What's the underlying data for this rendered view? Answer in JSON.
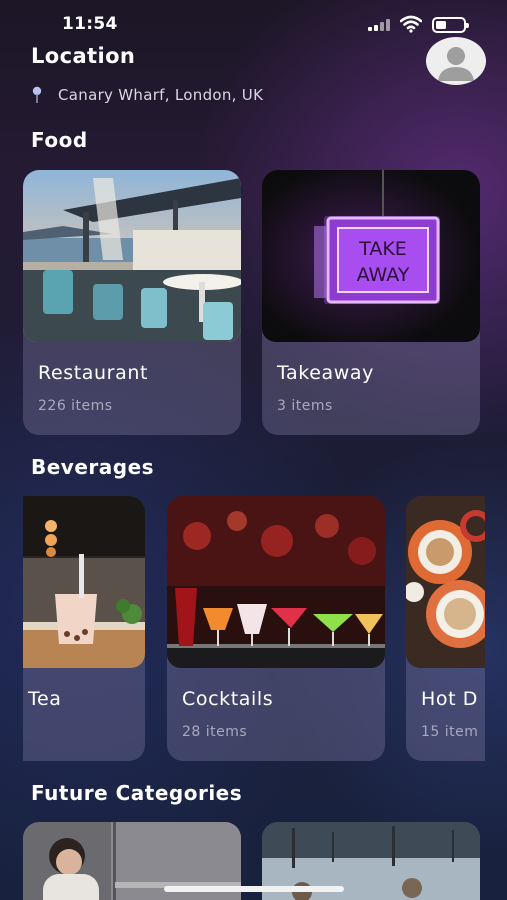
{
  "status_bar": {
    "time": "11:54"
  },
  "header": {
    "title": "Location",
    "location": "Canary Wharf, London, UK"
  },
  "icons": {
    "pin": "pin-icon",
    "avatar": "user-avatar-icon",
    "signal": "cellular-signal-icon",
    "wifi": "wifi-icon",
    "battery": "battery-icon"
  },
  "sections": {
    "food": {
      "title": "Food",
      "items": [
        {
          "name": "Restaurant",
          "count": "226 items"
        },
        {
          "name": "Takeaway",
          "count": "3 items"
        }
      ]
    },
    "beverages": {
      "title": "Beverages",
      "items": [
        {
          "name": "Tea",
          "count": ""
        },
        {
          "name": "Cocktails",
          "count": "28 items"
        },
        {
          "name": "Hot D",
          "count": "15 item"
        }
      ]
    },
    "future": {
      "title": "Future Categories"
    }
  },
  "neon_sign": {
    "line1": "TAKE",
    "line2": "AWAY"
  },
  "colors": {
    "accent_neon": "#b35cff",
    "card_bg": "#6e6a96"
  }
}
